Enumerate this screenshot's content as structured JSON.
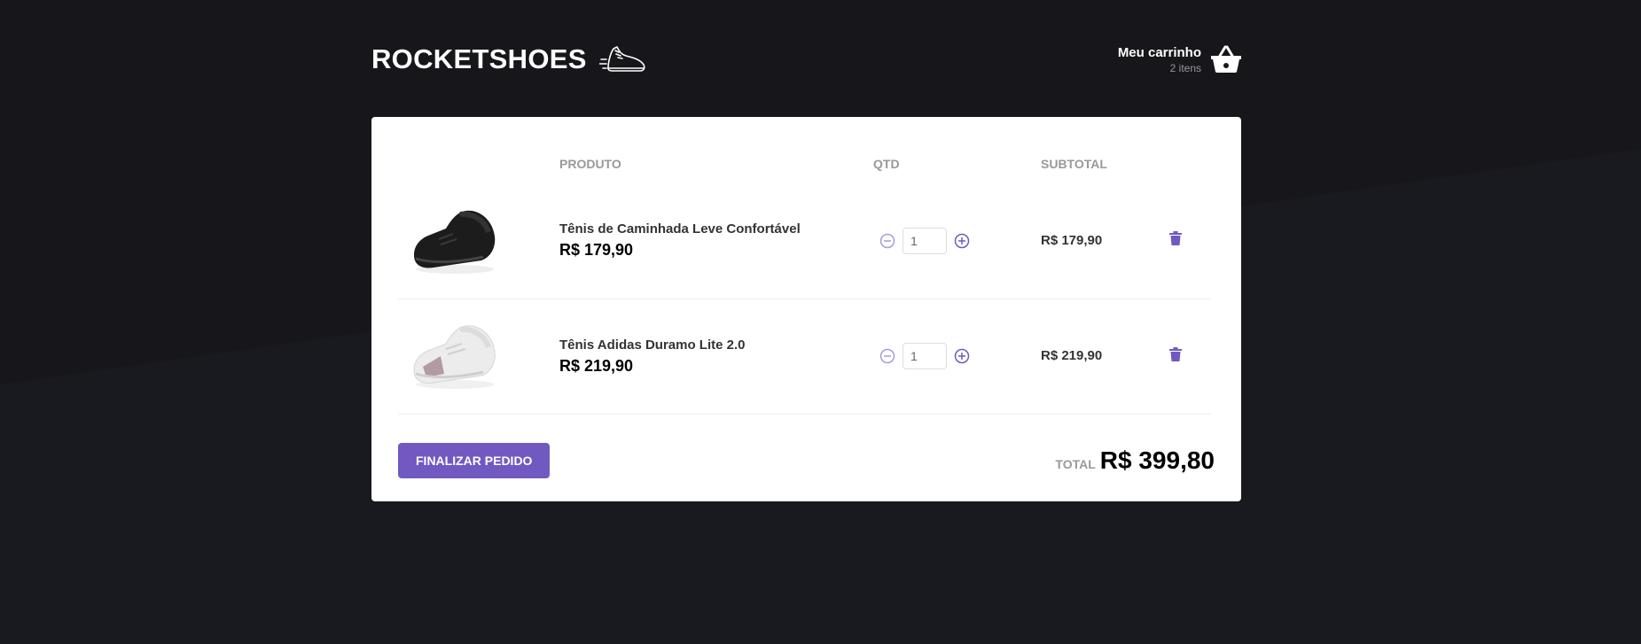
{
  "header": {
    "brand": "ROCKETSHOES",
    "cart_title": "Meu carrinho",
    "cart_count": "2 itens"
  },
  "table": {
    "columns": [
      "",
      "PRODUTO",
      "QTD",
      "SUBTOTAL",
      ""
    ],
    "rows": [
      {
        "title": "Tênis de Caminhada Leve Confortável",
        "price": "R$ 179,90",
        "qty": "1",
        "subtotal": "R$ 179,90",
        "shoe_color": "black"
      },
      {
        "title": "Tênis Adidas Duramo Lite 2.0",
        "price": "R$ 219,90",
        "qty": "1",
        "subtotal": "R$ 219,90",
        "shoe_color": "white"
      }
    ]
  },
  "footer": {
    "checkout_label": "FINALIZAR PEDIDO",
    "total_label": "TOTAL",
    "total_value": "R$ 399,80"
  },
  "colors": {
    "background": "#191920",
    "accent": "#7159c1",
    "card": "#ffffff"
  }
}
